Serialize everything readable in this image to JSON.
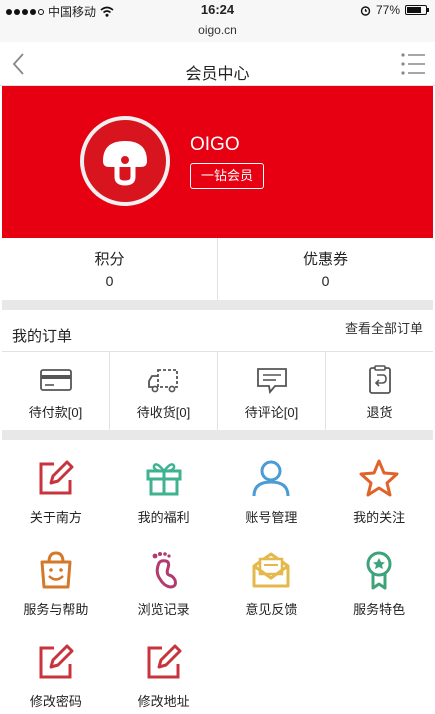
{
  "status_bar": {
    "carrier": "中国移动",
    "time": "16:24",
    "battery": "77%",
    "battery_level": 0.77
  },
  "url": "oigo.cn",
  "nav": {
    "title": "会员中心"
  },
  "profile": {
    "name": "OIGO",
    "level": "一钻会员"
  },
  "stats": [
    {
      "label": "积分",
      "value": "0"
    },
    {
      "label": "优惠券",
      "value": "0"
    }
  ],
  "orders": {
    "title": "我的订单",
    "view_all": "查看全部订单",
    "items": [
      {
        "label": "待付款[0]",
        "icon": "card-icon"
      },
      {
        "label": "待收货[0]",
        "icon": "truck-icon"
      },
      {
        "label": "待评论[0]",
        "icon": "comment-icon"
      },
      {
        "label": "退货",
        "icon": "return-icon"
      }
    ]
  },
  "features": [
    {
      "label": "关于南方",
      "icon": "edit-icon"
    },
    {
      "label": "我的福利",
      "icon": "gift-icon"
    },
    {
      "label": "账号管理",
      "icon": "user-icon"
    },
    {
      "label": "我的关注",
      "icon": "star-icon"
    },
    {
      "label": "服务与帮助",
      "icon": "bag-icon"
    },
    {
      "label": "浏览记录",
      "icon": "footprint-icon"
    },
    {
      "label": "意见反馈",
      "icon": "envelope-icon"
    },
    {
      "label": "服务特色",
      "icon": "ribbon-icon"
    },
    {
      "label": "修改密码",
      "icon": "edit-icon"
    },
    {
      "label": "修改地址",
      "icon": "edit-icon"
    }
  ],
  "colors": {
    "brand_red": "#e60012",
    "edit": "#c8343e",
    "gift": "#3fb28f",
    "user": "#4a9bd6",
    "star": "#e0632a",
    "bag": "#d6782a",
    "footprint": "#b23a6e",
    "envelope": "#e4b84a",
    "ribbon": "#3fa37a"
  }
}
